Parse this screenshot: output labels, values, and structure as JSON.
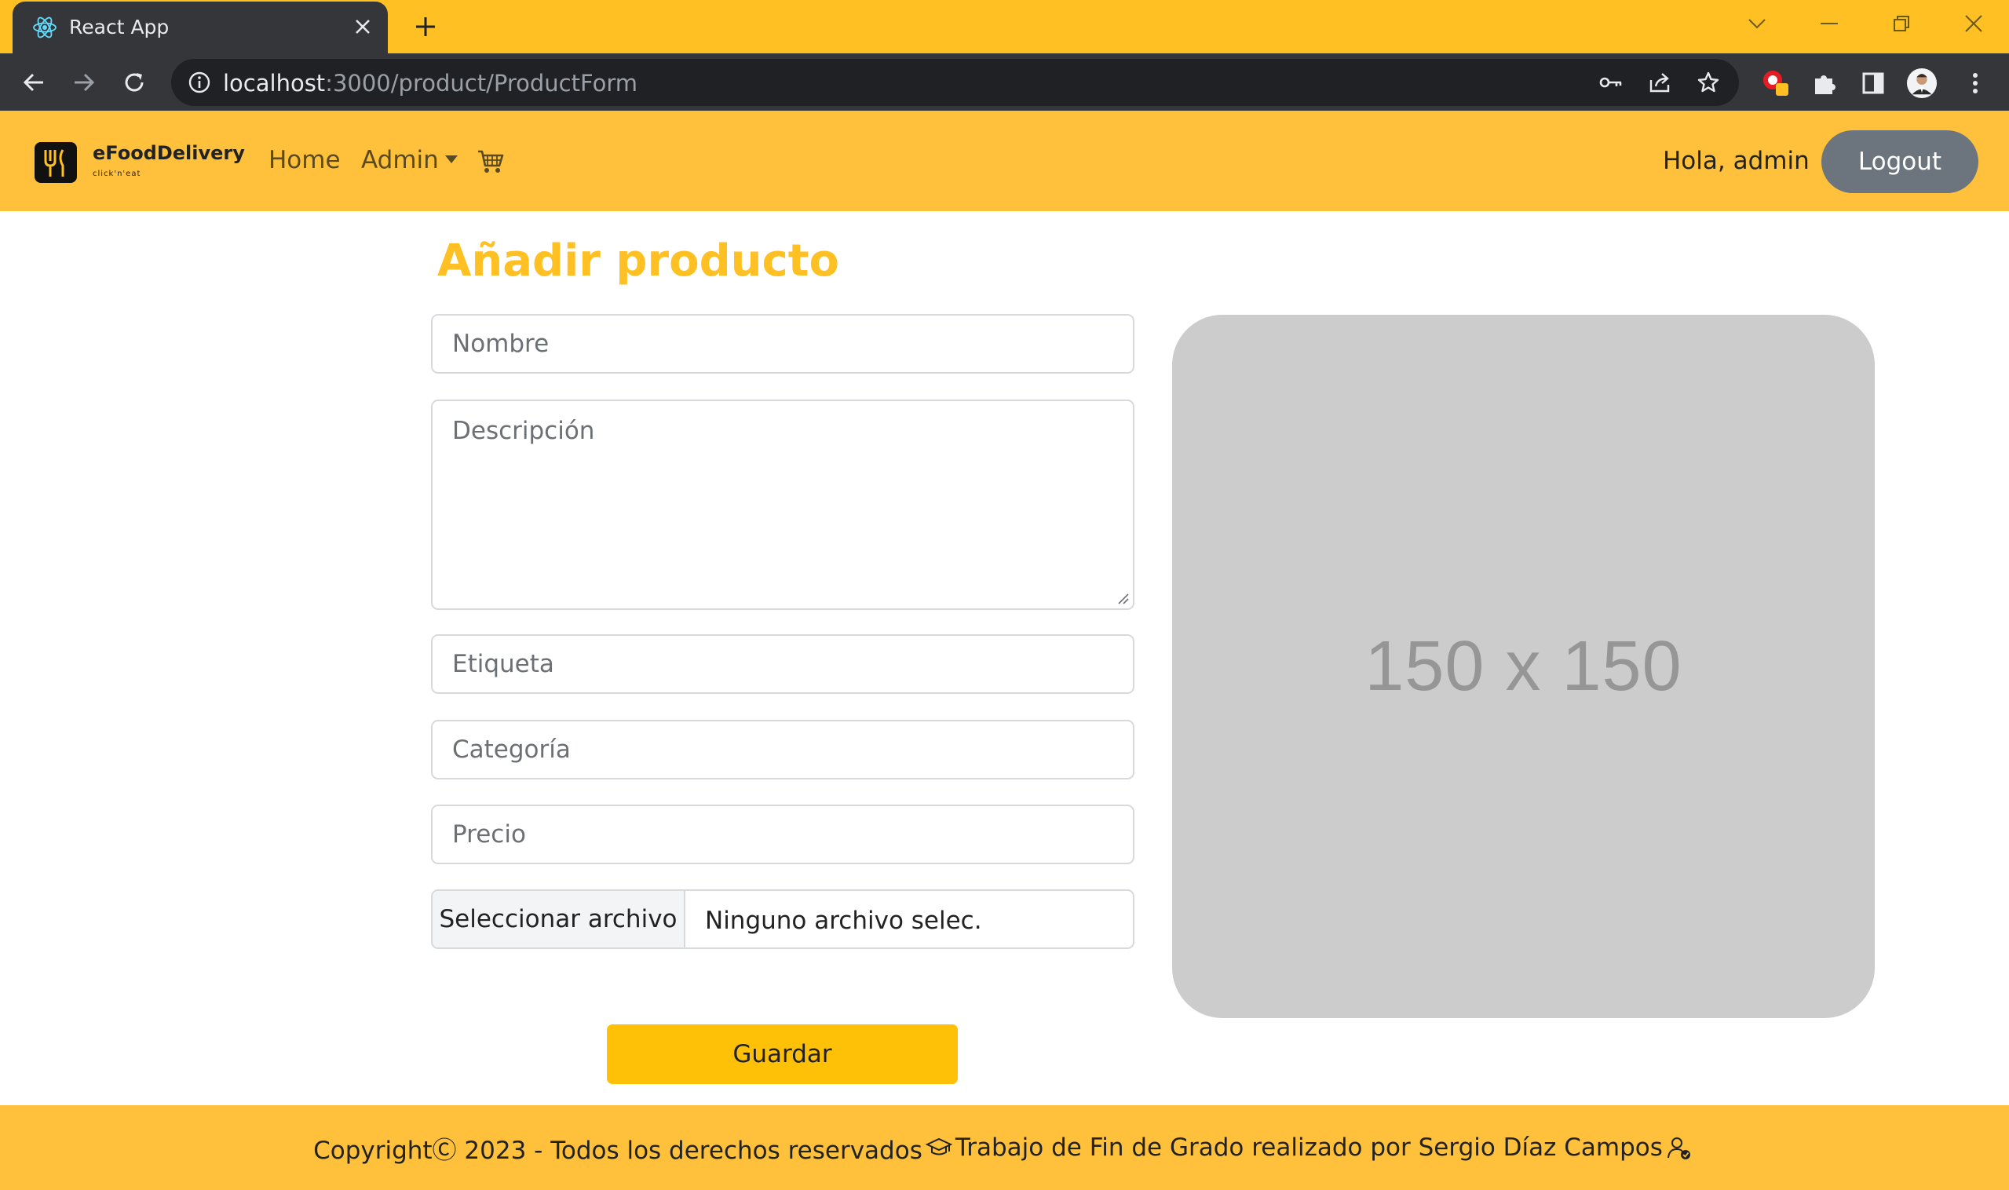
{
  "browser": {
    "tab_title": "React App",
    "url_host": "localhost",
    "url_path": ":3000/product/ProductForm",
    "icons": [
      "react-favicon",
      "close-icon",
      "plus-icon",
      "chevron-down-icon",
      "minimize-icon",
      "restore-icon",
      "window-close-icon",
      "back-arrow-icon",
      "forward-arrow-icon",
      "reload-icon",
      "info-icon",
      "key-icon",
      "share-icon",
      "star-icon",
      "extension-icon",
      "puzzle-icon",
      "sidepanel-icon",
      "avatar",
      "kebab-menu-icon"
    ]
  },
  "navbar": {
    "brand_name": "eFoodDelivery",
    "brand_tagline": "click'n'eat",
    "home_label": "Home",
    "admin_label": "Admin",
    "cart_icon": "cart-icon",
    "greeting": "Hola, admin",
    "logout_label": "Logout",
    "background": "#ffc13b"
  },
  "form": {
    "title": "Añadir producto",
    "title_color": "#fec022",
    "nombre_placeholder": "Nombre",
    "descripcion_placeholder": "Descripción",
    "etiqueta_placeholder": "Etiqueta",
    "categoria_placeholder": "Categoría",
    "precio_placeholder": "Precio",
    "file_button_label": "Seleccionar archivo",
    "file_status": "Ninguno archivo selec.",
    "save_label": "Guardar",
    "save_color": "#fec107"
  },
  "preview": {
    "placeholder_text": "150 x 150"
  },
  "footer": {
    "copyright_text": "CopyrightⒸ 2023 - Todos los derechos reservados",
    "credit_text": "Trabajo de Fin de Grado realizado por Sergio Díaz Campos",
    "icons": [
      "graduation-cap-icon",
      "user-check-icon"
    ]
  }
}
